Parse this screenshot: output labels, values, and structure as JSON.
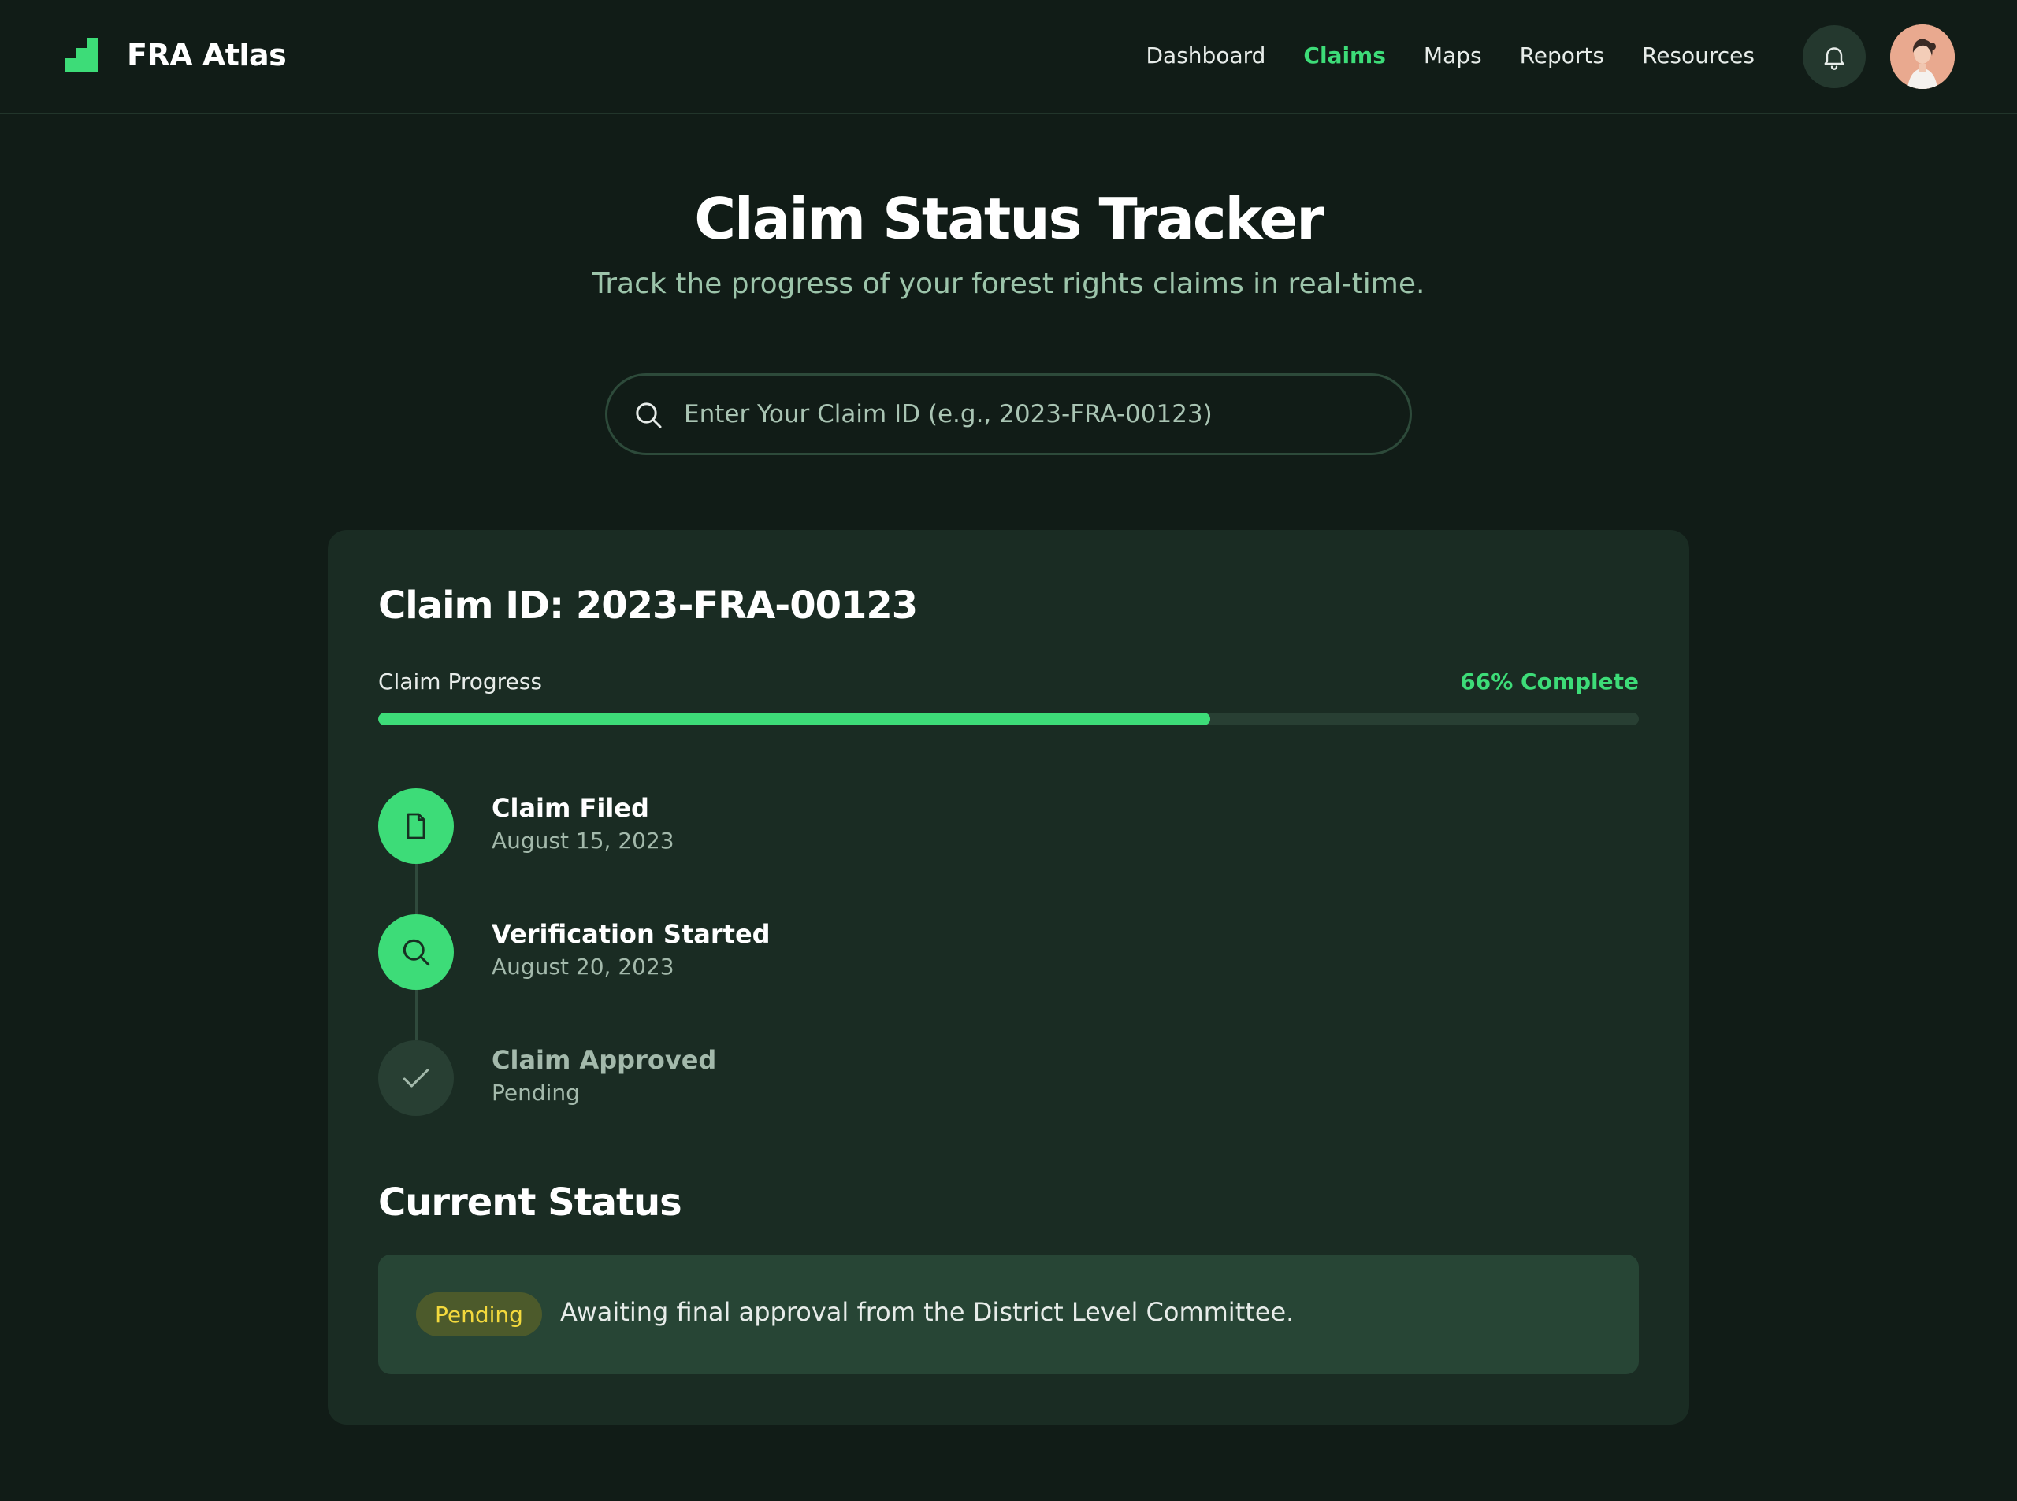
{
  "app": {
    "brand_name": "FRA Atlas",
    "logo_icon": "stairs-logo-icon"
  },
  "nav": {
    "items": [
      {
        "label": "Dashboard",
        "active": false
      },
      {
        "label": "Claims",
        "active": true
      },
      {
        "label": "Maps",
        "active": false
      },
      {
        "label": "Reports",
        "active": false
      },
      {
        "label": "Resources",
        "active": false
      }
    ],
    "notifications_icon": "bell-icon",
    "avatar_icon": "user-avatar"
  },
  "hero": {
    "title": "Claim Status Tracker",
    "subtitle": "Track the progress of your forest rights claims in real-time."
  },
  "search": {
    "icon": "search-icon",
    "placeholder": "Enter Your Claim ID (e.g., 2023-FRA-00123)",
    "value": ""
  },
  "claim": {
    "id_label": "Claim ID: 2023-FRA-00123",
    "progress_label": "Claim Progress",
    "progress_text": "66% Complete",
    "progress_fraction": 0.66,
    "steps": [
      {
        "title": "Claim Filed",
        "date": "August 15, 2023",
        "state": "done",
        "icon": "document-icon"
      },
      {
        "title": "Verification Started",
        "date": "August 20, 2023",
        "state": "done",
        "icon": "search-icon"
      },
      {
        "title": "Claim Approved",
        "date": "Pending",
        "state": "pending",
        "icon": "check-icon"
      }
    ]
  },
  "current_status": {
    "heading": "Current Status",
    "badge": "Pending",
    "message": "Awaiting final approval from the District Level Committee."
  },
  "colors": {
    "background": "#111c17",
    "card": "#1a2c23",
    "accent": "#3ddc78",
    "pending_badge_bg": "#4c5a2b",
    "pending_badge_text": "#f3d93d"
  }
}
